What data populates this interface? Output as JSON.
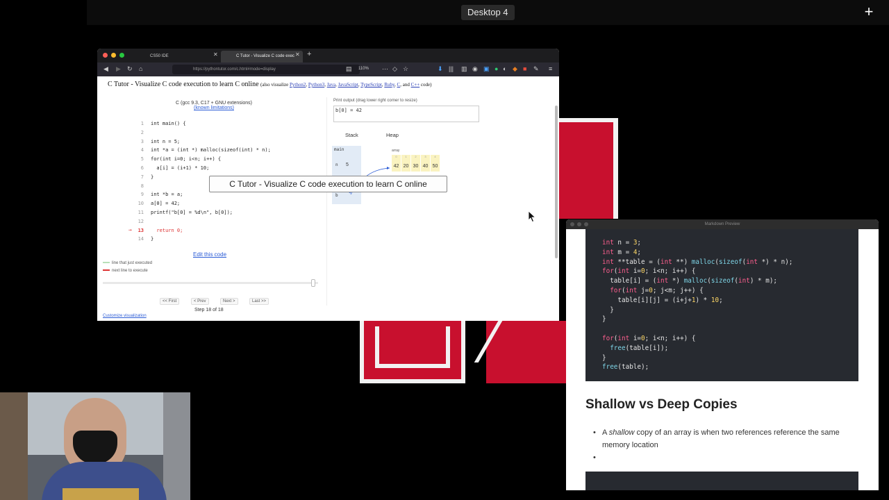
{
  "desktop": {
    "label": "Desktop 4",
    "plus_icon": "plus-icon"
  },
  "browser": {
    "tabs": [
      {
        "label": "CS50 IDE"
      },
      {
        "label": "C Tutor - Visualize C code exec"
      }
    ],
    "url": "https://pythontutor.com/c.html#mode=display",
    "zoom": "110%"
  },
  "tutor": {
    "title": "C Tutor - Visualize C code execution to learn C online",
    "title_prefix": "(also visualize",
    "title_links": [
      "Python2",
      "Python3",
      "Java",
      "JavaScript",
      "TypeScript",
      "Ruby",
      "C",
      "and",
      "C++"
    ],
    "title_suffix": "code)",
    "compiler": "C (gcc 9.3, C17 + GNU extensions)",
    "known_limitations": "(known limitations)",
    "code_lines": [
      {
        "n": "1",
        "text": "int main() {"
      },
      {
        "n": "2",
        "text": ""
      },
      {
        "n": "3",
        "text": "int n = 5;"
      },
      {
        "n": "4",
        "text": "int *a = (int *) malloc(sizeof(int) * n);"
      },
      {
        "n": "5",
        "text": "for(int i=0; i<n; i++) {"
      },
      {
        "n": "6",
        "text": "  a[i] = (i+1) * 10;"
      },
      {
        "n": "7",
        "text": "}"
      },
      {
        "n": "8",
        "text": ""
      },
      {
        "n": "9",
        "text": "int *b = a;"
      },
      {
        "n": "10",
        "text": "a[0] = 42;"
      },
      {
        "n": "11",
        "text": "printf(\"b[0] = %d\\n\", b[0]);"
      },
      {
        "n": "12",
        "text": ""
      },
      {
        "n": "13",
        "text": "  return 0;"
      },
      {
        "n": "14",
        "text": "}"
      }
    ],
    "current_line": "13",
    "edit_code": "Edit this code",
    "legend_executed": "line that just executed",
    "legend_next": "next line to execute",
    "nav": {
      "first": "<< First",
      "prev": "< Prev",
      "next": "Next >",
      "last": "Last >>"
    },
    "step": "Step 18 of 18",
    "customize": "Customize visualization",
    "print_label": "Print output (drag lower right corner to resize)",
    "print_output": "b[0] = 42",
    "stack_label": "Stack",
    "heap_label": "Heap",
    "frame_name": "main",
    "vars": [
      {
        "name": "n",
        "value": "5"
      },
      {
        "name": "a",
        "value": ""
      },
      {
        "name": "b",
        "value": ""
      }
    ],
    "array_label": "array",
    "array_values": [
      "42",
      "20",
      "30",
      "40",
      "50"
    ],
    "array_indices": [
      "0",
      "1",
      "2",
      "3",
      "4"
    ],
    "tooltip": "C Tutor - Visualize C code execution to learn C online"
  },
  "markdown": {
    "window_title": "Markdown Preview",
    "code_lines": [
      "int n = 3;",
      "int m = 4;",
      "int **table = (int **) malloc(sizeof(int *) * n);",
      "for(int i=0; i<n; i++) {",
      "  table[i] = (int *) malloc(sizeof(int) * m);",
      "  for(int j=0; j<m; j++) {",
      "    table[i][j] = (i+j+1) * 10;",
      "  }",
      "}",
      "",
      "for(int i=0; i<n; i++) {",
      "  free(table[i]);",
      "}",
      "free(table);"
    ],
    "heading": "Shallow vs Deep Copies",
    "bullet1_pre": "A ",
    "bullet1_em": "shallow",
    "bullet1_post": " copy of an array is when two references reference the same memory location",
    "bullet2": ""
  },
  "colors": {
    "red": "#c8102e",
    "accent_link": "#2a5bd6",
    "current_line": "#dd3333"
  }
}
